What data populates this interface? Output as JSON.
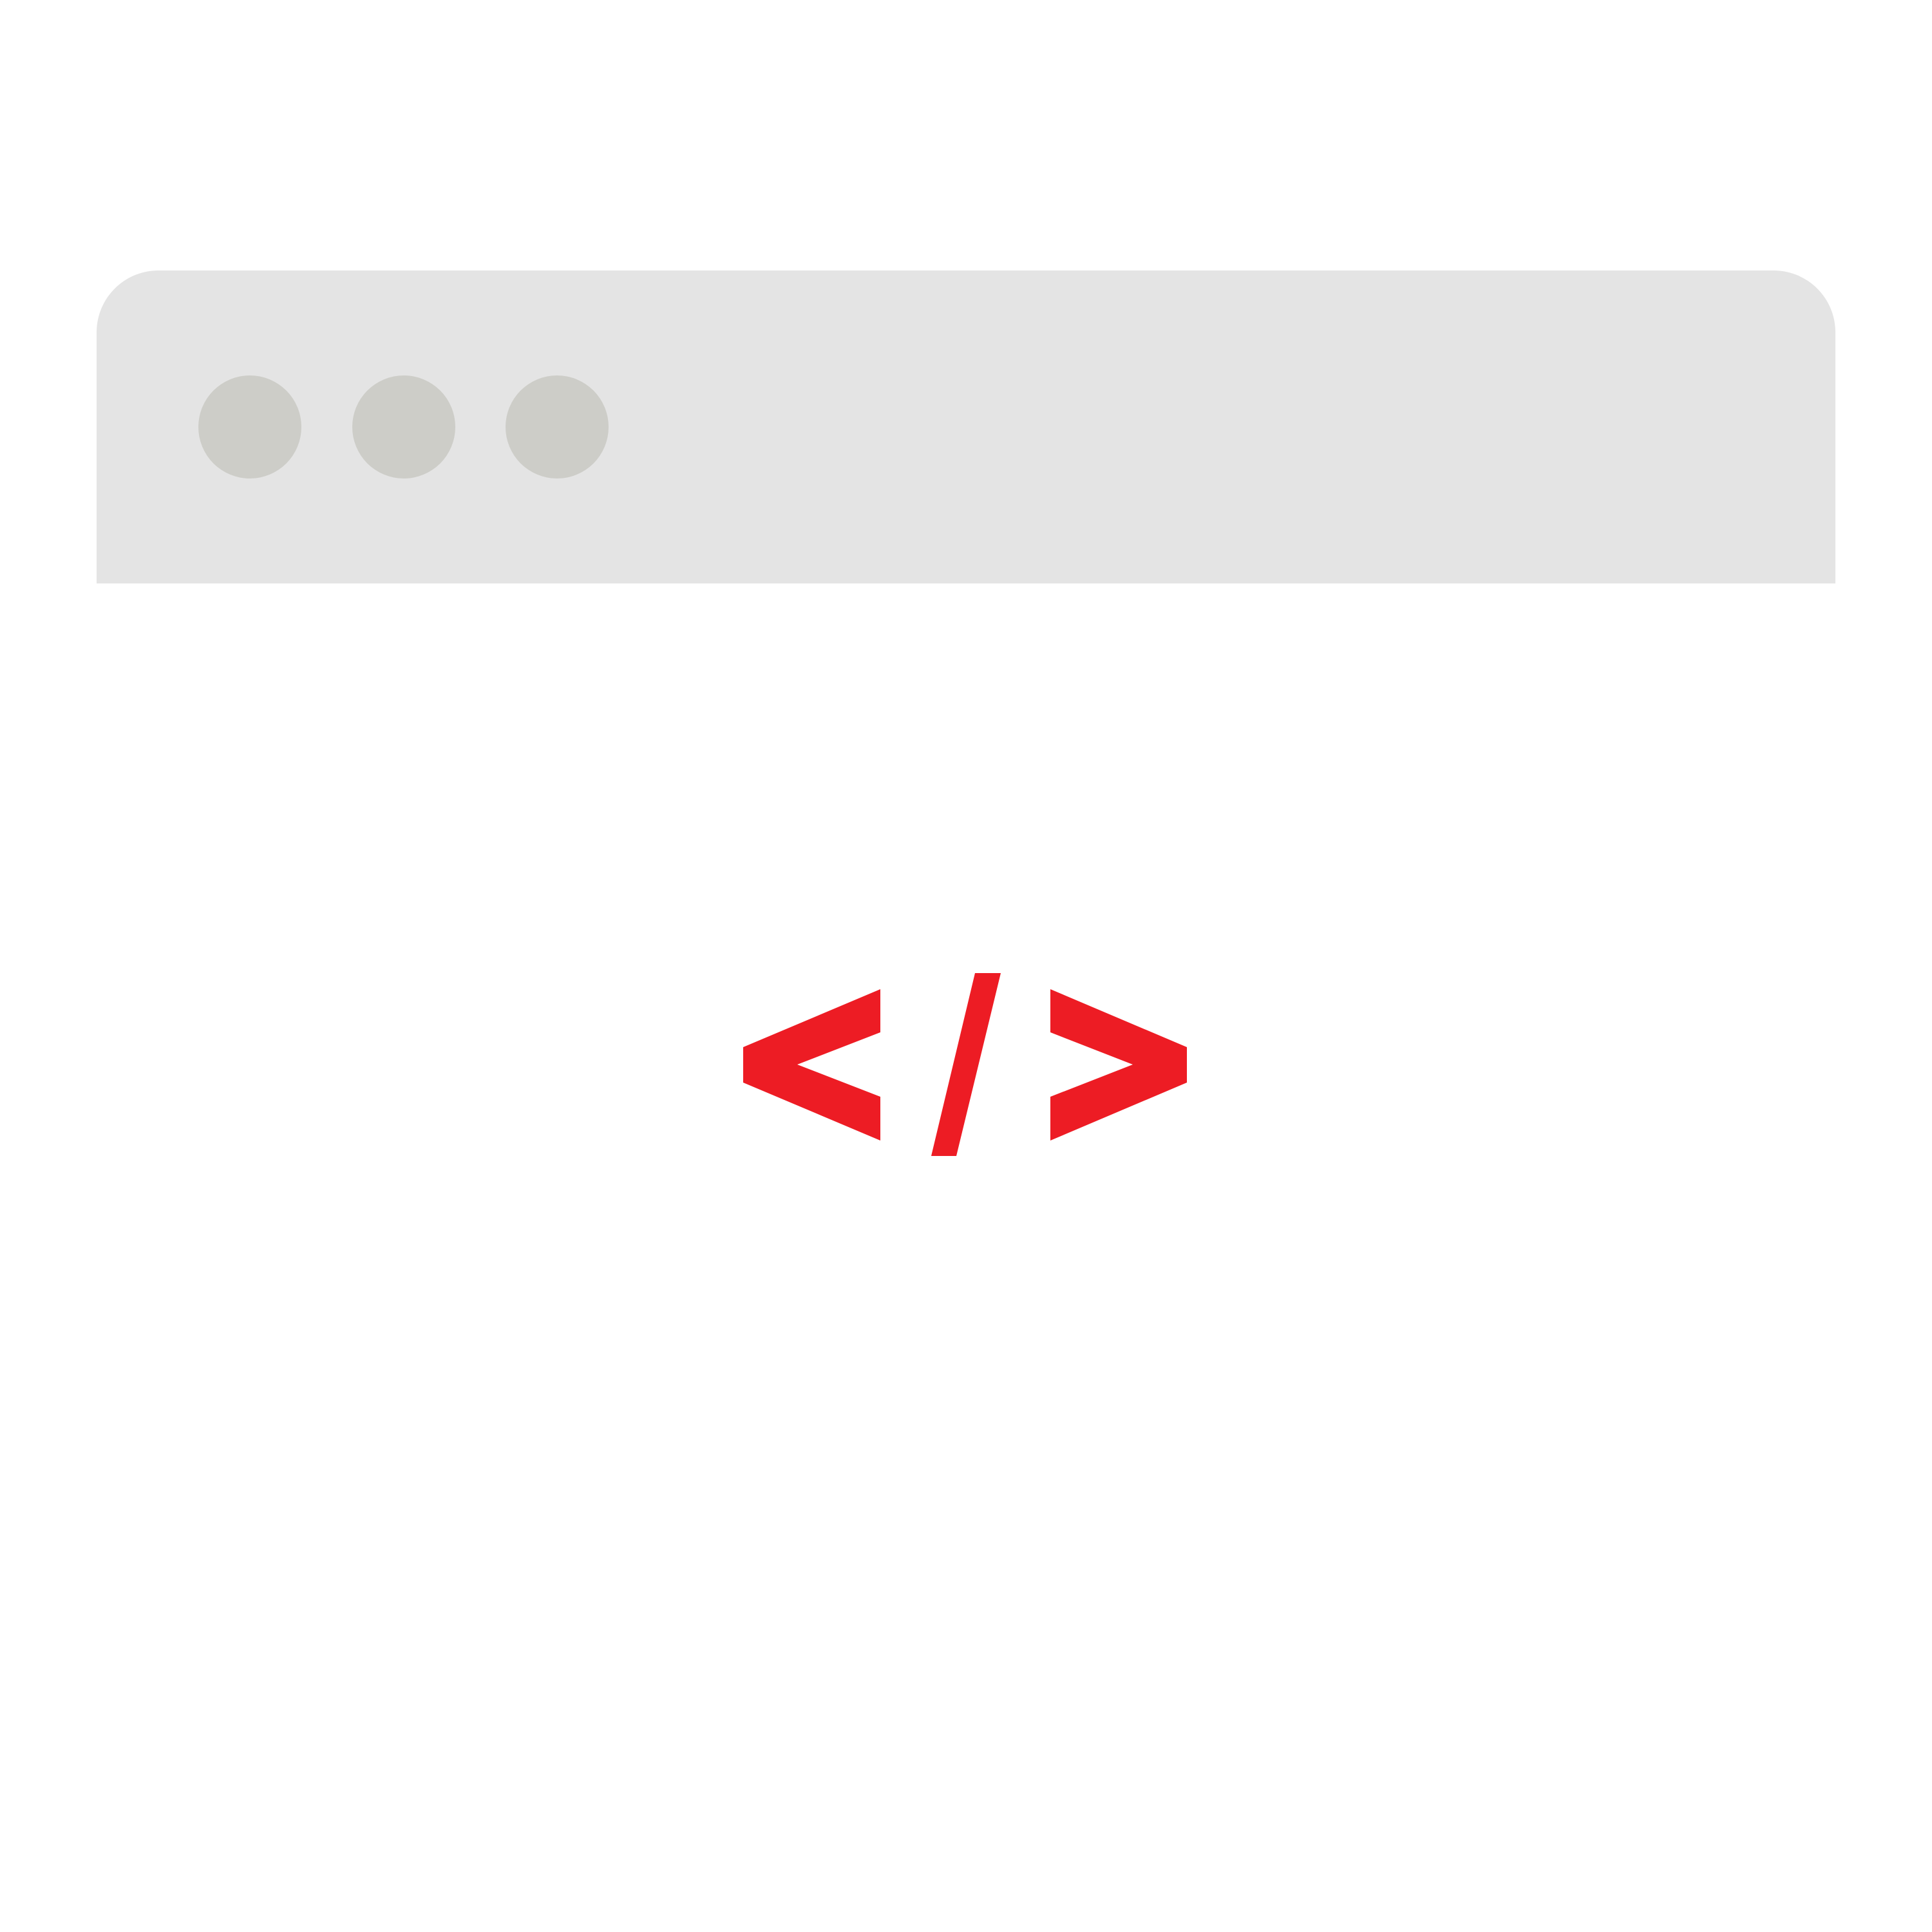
{
  "window": {
    "titlebar_buttons": [
      {
        "icon": "window-dot-icon"
      },
      {
        "icon": "window-dot-icon"
      },
      {
        "icon": "window-dot-icon"
      }
    ]
  },
  "content": {
    "icon": "code-brackets-icon",
    "icon_color": "#ed1c24"
  },
  "colors": {
    "titlebar": "#e4e4e4",
    "dots": "#cdcdc8",
    "background": "#ffffff"
  }
}
